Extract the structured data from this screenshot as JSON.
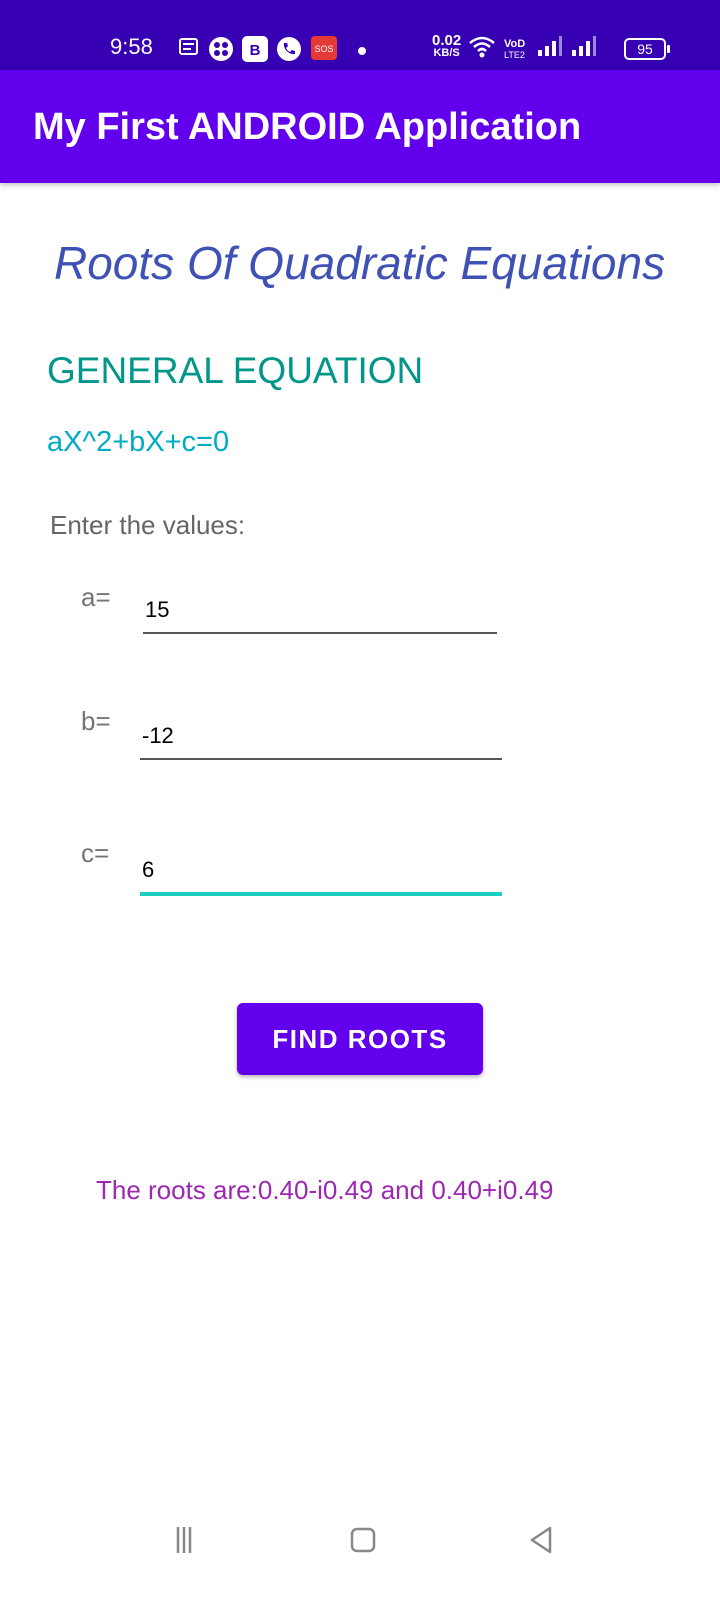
{
  "status_bar": {
    "time": "9:58",
    "net_speed": "0.02",
    "net_unit": "KB/S",
    "volte": "VoLTE2",
    "battery": "95",
    "icons": [
      "message-icon",
      "grid-app-icon",
      "b-app-icon",
      "phone-icon",
      "sos-icon",
      "dot-icon",
      "wifi-icon",
      "signal-icon",
      "signal-icon-2"
    ]
  },
  "app_bar": {
    "title": "My First ANDROID Application"
  },
  "main": {
    "heading": "Roots Of Quadratic Equations",
    "general_label": "GENERAL EQUATION",
    "formula": "aX^2+bX+c=0",
    "prompt": "Enter the values:",
    "fields": [
      {
        "label": "a=",
        "value": "15"
      },
      {
        "label": "b=",
        "value": "-12"
      },
      {
        "label": "c=",
        "value": "6"
      }
    ],
    "button_label": "FIND ROOTS",
    "result": "The roots are:0.40-i0.49 and 0.40+i0.49"
  },
  "nav": {
    "icons": [
      "recents-icon",
      "home-icon",
      "back-icon"
    ]
  },
  "colors": {
    "status_bar": "#3700b3",
    "app_bar": "#6200ee",
    "heading": "#3f51b5",
    "general": "#009688",
    "formula": "#00acc1",
    "result": "#9c27b0",
    "focus_underline": "#1ccfc0"
  }
}
